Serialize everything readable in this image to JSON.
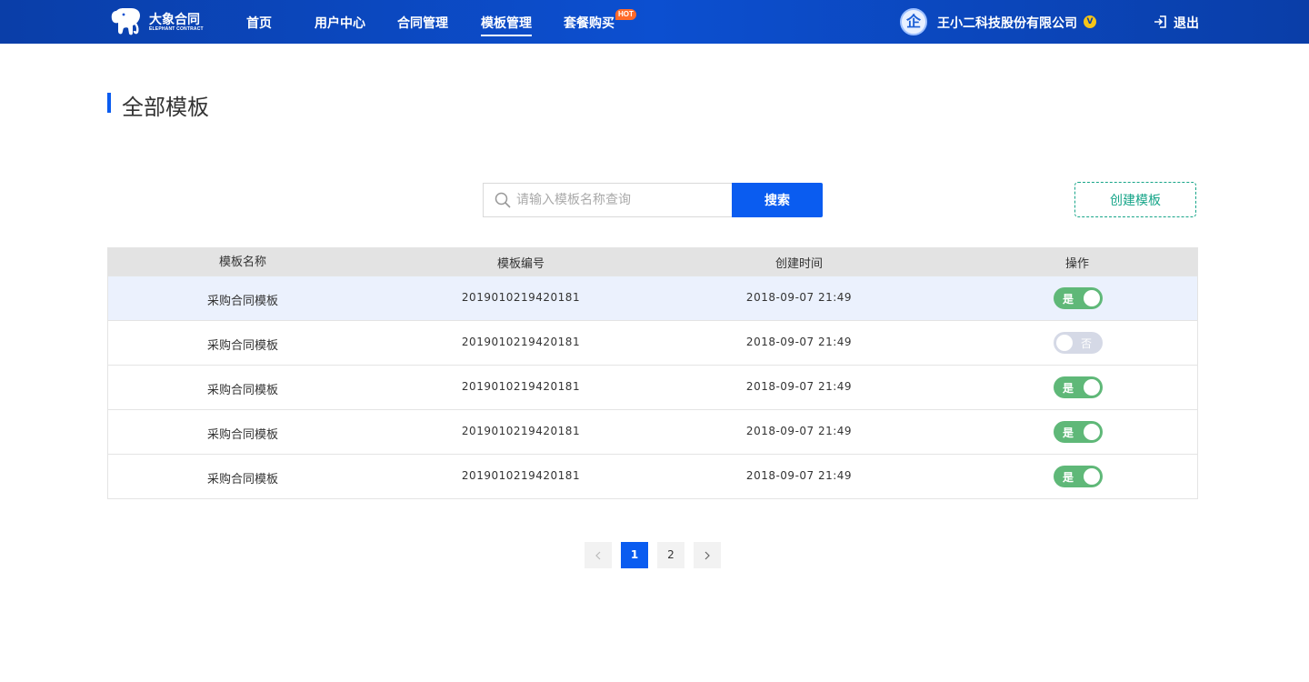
{
  "header": {
    "logo": {
      "brand": "大象合同",
      "brand_sub": "ELEPHANT CONTRACT"
    },
    "nav": [
      {
        "label": "首页",
        "active": false
      },
      {
        "label": "用户中心",
        "active": false
      },
      {
        "label": "合同管理",
        "active": false
      },
      {
        "label": "模板管理",
        "active": true
      },
      {
        "label": "套餐购买",
        "active": false,
        "badge": "HOT"
      }
    ],
    "company": {
      "avatar_glyph": "企",
      "name": "王小二科技股份有限公司",
      "vip_glyph": "V"
    },
    "logout_label": "退出"
  },
  "page": {
    "title": "全部模板"
  },
  "search": {
    "placeholder": "请输入模板名称查询",
    "value": "",
    "button_label": "搜索"
  },
  "create_button_label": "创建模板",
  "table": {
    "columns": [
      "模板名称",
      "模板编号",
      "创建时间",
      "操作"
    ],
    "rows": [
      {
        "name": "采购合同模板",
        "code": "2019010219420181",
        "created": "2018-09-07  21:49",
        "enabled": true,
        "toggle_label": "是"
      },
      {
        "name": "采购合同模板",
        "code": "2019010219420181",
        "created": "2018-09-07  21:49",
        "enabled": false,
        "toggle_label": "否"
      },
      {
        "name": "采购合同模板",
        "code": "2019010219420181",
        "created": "2018-09-07  21:49",
        "enabled": true,
        "toggle_label": "是"
      },
      {
        "name": "采购合同模板",
        "code": "2019010219420181",
        "created": "2018-09-07  21:49",
        "enabled": true,
        "toggle_label": "是"
      },
      {
        "name": "采购合同模板",
        "code": "2019010219420181",
        "created": "2018-09-07  21:49",
        "enabled": true,
        "toggle_label": "是"
      }
    ]
  },
  "pagination": {
    "pages": [
      "1",
      "2"
    ],
    "current": "1",
    "prev_icon": "chevron-left-icon",
    "next_icon": "chevron-right-icon"
  },
  "colors": {
    "header": "#0c4fd0",
    "accent": "#0a5cf0",
    "create": "#17a589",
    "toggle_on": "#5fb878",
    "toggle_off": "#d5d9e6",
    "hot": "#ff6a2a"
  }
}
